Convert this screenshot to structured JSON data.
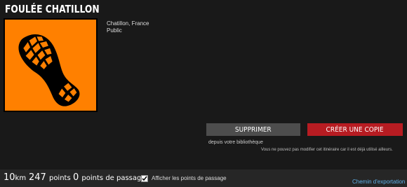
{
  "route": {
    "title": "FOULÉE CHATILLON",
    "location": "Chatillon, France",
    "visibility": "Public"
  },
  "thumbnail": {
    "icon": "running-shoe-icon",
    "background_color": "#ff8000"
  },
  "actions": {
    "delete_label": "SUPPRIMER",
    "delete_sub": "depuis votre bibliothèque",
    "copy_label": "CRÉER UNE COPIE",
    "note": "Vous ne pouvez pas modifier cet itinéraire car il est déjà utilisé ailleurs."
  },
  "stats": {
    "distance_value": "10",
    "distance_unit": "km",
    "points_value": "247",
    "points_label": "points",
    "waypoints_value": "0",
    "waypoints_label": "points de passage",
    "show_waypoints_label": "Afficher les points de passage",
    "show_waypoints_checked": true,
    "export_link": "Chemin d'exportation"
  },
  "colors": {
    "accent_orange": "#ff8000",
    "copy_button_red": "#b71c22",
    "link_blue": "#5fb0e8"
  }
}
